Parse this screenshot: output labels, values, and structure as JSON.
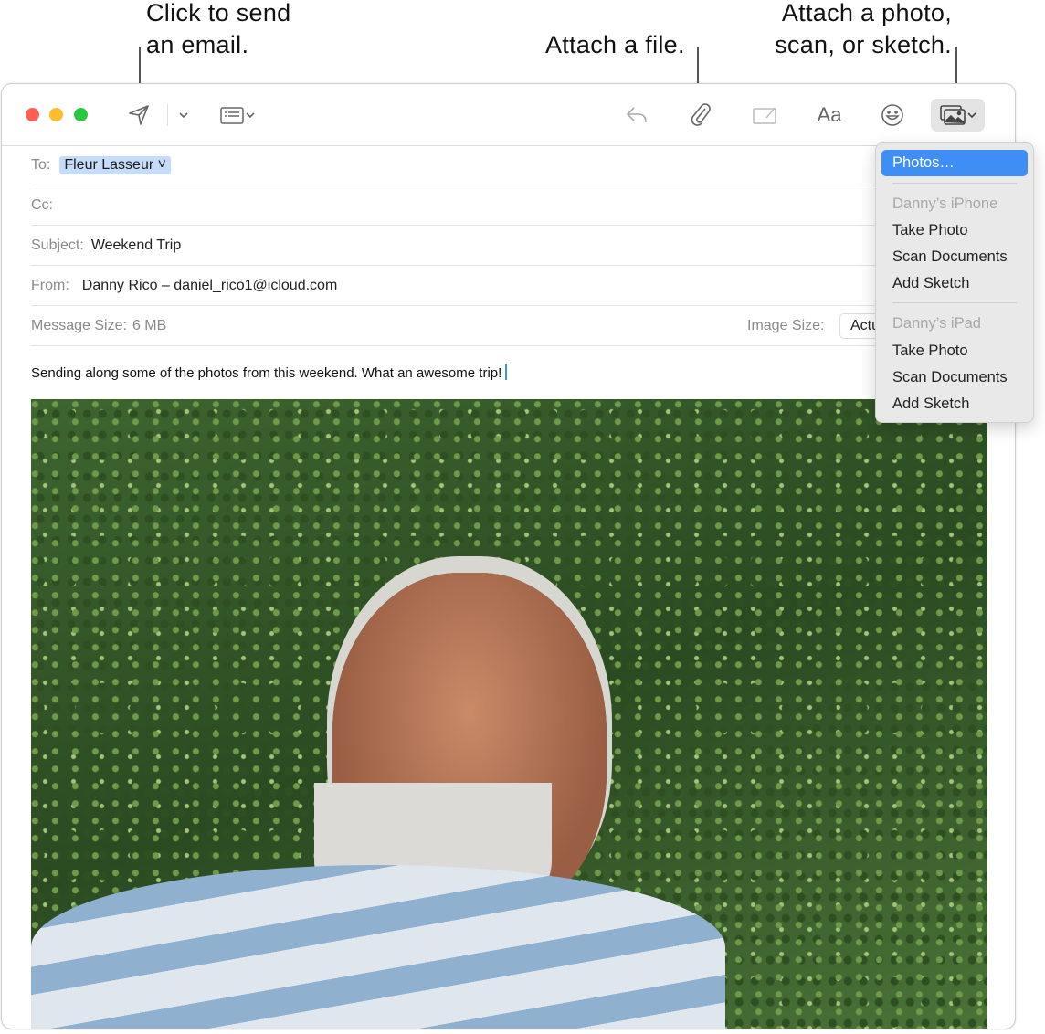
{
  "callouts": {
    "send": [
      "Click to send",
      "an email."
    ],
    "attach_file": "Attach a file.",
    "attach_photo": [
      "Attach a photo,",
      "scan, or sketch."
    ]
  },
  "compose": {
    "to_label": "To:",
    "to_value": "Fleur Lasseur",
    "cc_label": "Cc:",
    "subject_label": "Subject:",
    "subject_value": "Weekend Trip",
    "from_label": "From:",
    "from_value": "Danny Rico – daniel_rico1@icloud.com",
    "message_size_label": "Message Size:",
    "message_size_value": "6 MB",
    "image_size_label": "Image Size:",
    "image_size_value": "Actual Size",
    "body": "Sending along some of the photos from this weekend. What an awesome trip!"
  },
  "toolbar": {
    "icons": [
      "send-icon",
      "chevron-down-icon",
      "header-fields-icon",
      "reply-icon",
      "paperclip-icon",
      "markup-icon",
      "format-text-icon",
      "emoji-icon",
      "photo-browser-icon"
    ],
    "format_label": "Aa"
  },
  "menu": {
    "photos": "Photos…",
    "sections": [
      {
        "header": "Danny’s iPhone",
        "items": [
          "Take Photo",
          "Scan Documents",
          "Add Sketch"
        ]
      },
      {
        "header": "Danny’s iPad",
        "items": [
          "Take Photo",
          "Scan Documents",
          "Add Sketch"
        ]
      }
    ]
  },
  "colors": {
    "accent": "#3f8ef6",
    "close": "#ff5f57",
    "minimize": "#febc2e",
    "zoom": "#28c840",
    "recipient_chip": "#c7dcfb"
  }
}
